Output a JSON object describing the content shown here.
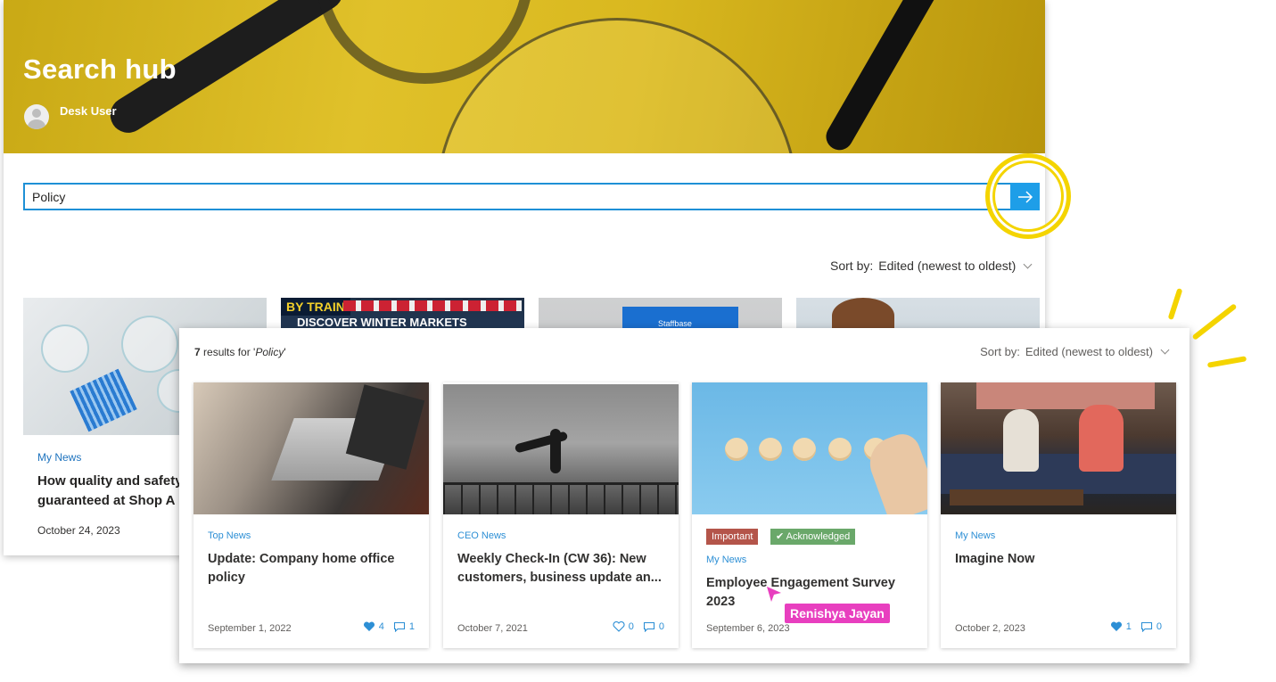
{
  "hero": {
    "title": "Search hub",
    "author": "Desk User"
  },
  "search": {
    "value": "Policy",
    "submit_icon": "arrow-right-icon"
  },
  "back_results": {
    "sort_label": "Sort by:",
    "sort_value": "Edited (newest to oldest)",
    "cards": [
      {
        "category": "My News",
        "title": "How quality and safety",
        "title2": "guaranteed at Shop A",
        "date": "October 24, 2023"
      },
      {
        "banner_top": "BY TRAIN",
        "banner_text": "DISCOVER WINTER MARKETS"
      },
      {
        "logo_text": "Staffbase"
      },
      {}
    ]
  },
  "front_results": {
    "count": "7",
    "count_suffix": " results for '",
    "query": "Policy",
    "count_end": "'",
    "sort_label": "Sort by:",
    "sort_value": "Edited (newest to oldest)",
    "cards": [
      {
        "category": "Top News",
        "title": "Update: Company home office policy",
        "date": "September 1, 2022",
        "likes": "4",
        "comments": "1",
        "liked": true
      },
      {
        "category": "CEO News",
        "title": "Weekly Check-In (CW 36): New customers, business update an...",
        "date": "October 7, 2021",
        "likes": "0",
        "comments": "0",
        "liked": false
      },
      {
        "category": "My News",
        "badge_important": "Important",
        "badge_acknowledged": "Acknowledged",
        "title": "Employee Engagement Survey 2023",
        "date": "September 6, 2023"
      },
      {
        "category": "My News",
        "title": "Imagine Now",
        "date": "October 2, 2023",
        "likes": "1",
        "comments": "0",
        "liked": true
      }
    ]
  },
  "cursor": {
    "label": "Renishya Jayan",
    "color": "#e83fbf"
  },
  "colors": {
    "accent": "#1e9ee8",
    "highlight": "#f4d400",
    "hero": "#d9b81f"
  }
}
